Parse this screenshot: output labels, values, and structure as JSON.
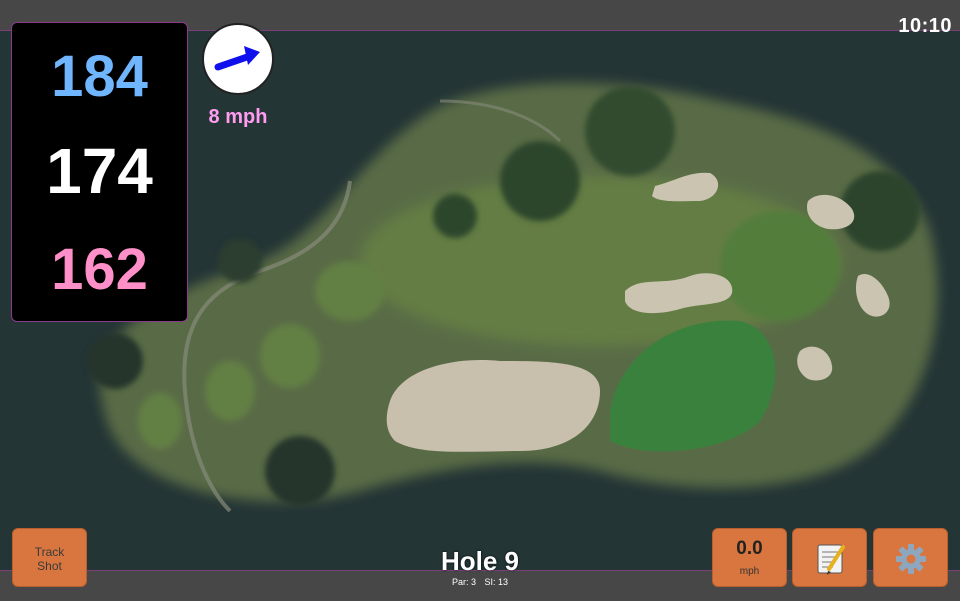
{
  "clock": "10:10",
  "distances": {
    "back": "184",
    "middle": "174",
    "front": "162"
  },
  "wind": {
    "speed": "8 mph",
    "icon": "wind-direction-arrow-icon"
  },
  "buttons": {
    "track_shot_line1": "Track",
    "track_shot_line2": "Shot",
    "speed_value": "0.0",
    "speed_unit": "mph",
    "notes_icon": "notepad-icon",
    "settings_icon": "gear-icon"
  },
  "hole": {
    "title": "Hole 9",
    "par": "Par: 3",
    "si": "SI: 13"
  },
  "colors": {
    "back": "#6fb6ff",
    "middle": "#ffffff",
    "front": "#ff8fc8",
    "button": "#d9763f",
    "wind_text": "#ff9cf0"
  }
}
